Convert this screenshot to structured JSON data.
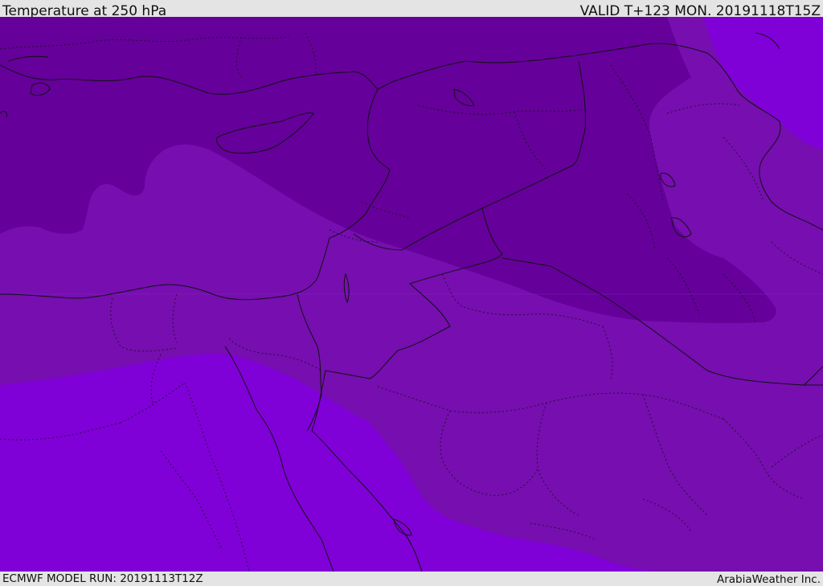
{
  "header": {
    "title": "Temperature at 250 hPa",
    "valid": "VALID T+123 MON. 20191118T15Z"
  },
  "footer": {
    "model_run": "ECMWF MODEL RUN: 20191113T12Z",
    "credit": "ArabiaWeather Inc."
  },
  "colors": {
    "band_coldest": "#65009a",
    "band_mid": "#760eb0",
    "band_warm": "#8000d8",
    "borders": "#111111"
  }
}
